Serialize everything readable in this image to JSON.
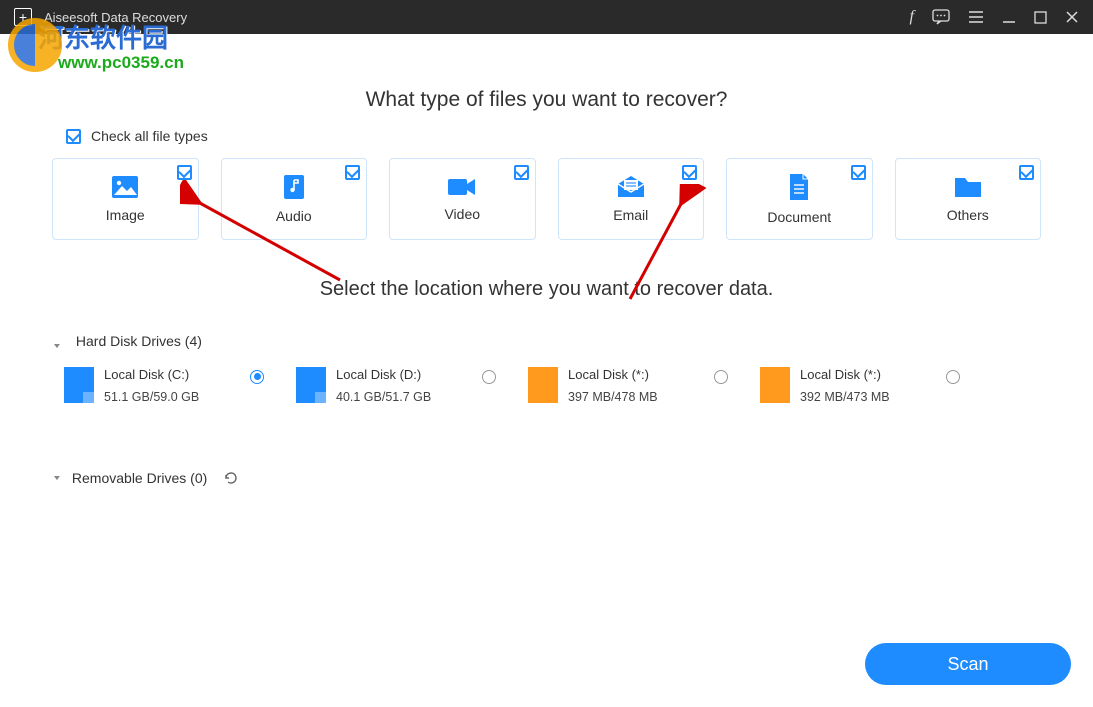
{
  "titlebar": {
    "title": "Aiseesoft Data Recovery"
  },
  "watermark": {
    "line1": "河东软件园",
    "line2": "www.pc0359.cn"
  },
  "heading_files": "What type of files you want to recover?",
  "check_all_label": "Check all file types",
  "cards": [
    {
      "label": "Image"
    },
    {
      "label": "Audio"
    },
    {
      "label": "Video"
    },
    {
      "label": "Email"
    },
    {
      "label": "Document"
    },
    {
      "label": "Others"
    }
  ],
  "heading_location": "Select the location where you want to recover data.",
  "hdd_label": "Hard Disk Drives (4)",
  "drives": [
    {
      "name": "Local Disk (C:)",
      "size": "51.1 GB/59.0 GB",
      "selected": true,
      "color": "blue"
    },
    {
      "name": "Local Disk (D:)",
      "size": "40.1 GB/51.7 GB",
      "selected": false,
      "color": "blue"
    },
    {
      "name": "Local Disk (*:)",
      "size": "397 MB/478 MB",
      "selected": false,
      "color": "orange"
    },
    {
      "name": "Local Disk (*:)",
      "size": "392 MB/473 MB",
      "selected": false,
      "color": "orange"
    }
  ],
  "removable_label": "Removable Drives (0)",
  "scan_button": "Scan"
}
